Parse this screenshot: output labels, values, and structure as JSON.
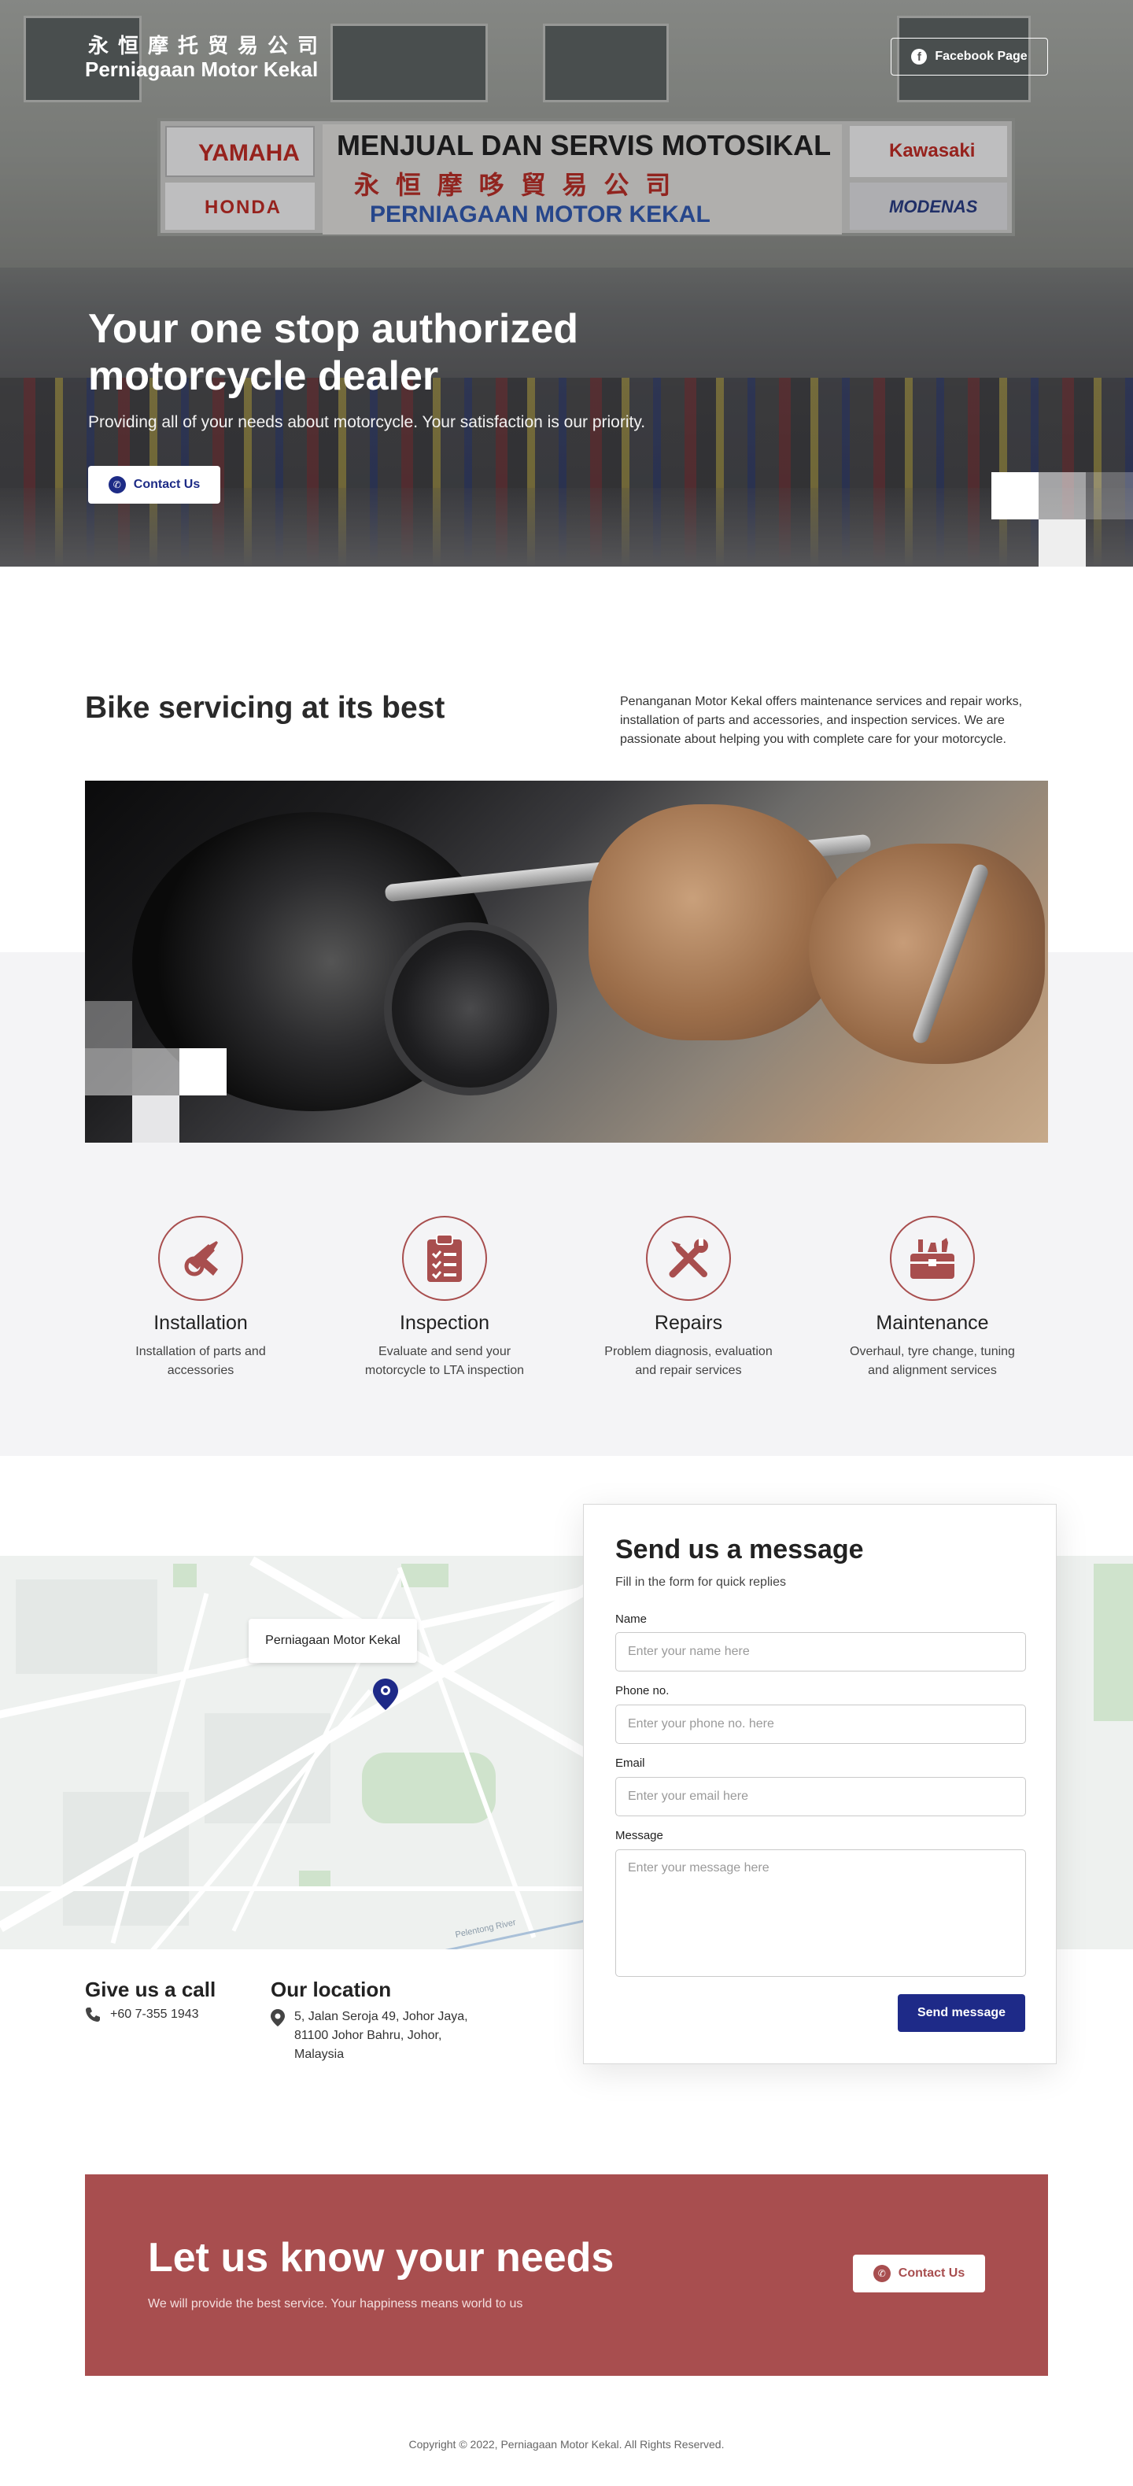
{
  "brand": {
    "name_cn": "永恒摩托贸易公司",
    "name_en": "Perniagaan Motor Kekal"
  },
  "hero": {
    "facebook_label": "Facebook Page",
    "title": "Your one stop authorized motorcycle dealer",
    "subtitle": "Providing all of your needs about motorcycle. Your satisfaction is our priority.",
    "contact_label": "Contact Us",
    "signs": {
      "yamaha": "YAMAHA",
      "honda": "HONDA",
      "main": "MENJUAL DAN SERVIS MOTOSIKAL",
      "cn": "永 恒 摩 哆 貿 易 公 司",
      "sub": "PERNIAGAAN MOTOR KEKAL",
      "kawasaki": "Kawasaki",
      "modenas": "MODENAS"
    }
  },
  "servicing": {
    "title": "Bike servicing at its best",
    "description": "Penanganan Motor Kekal offers maintenance services and repair works, installation of parts and accessories, and inspection services. We are passionate about helping you with complete care for your motorcycle."
  },
  "services": [
    {
      "title": "Installation",
      "description": "Installation of parts and accessories",
      "icon": "installation-icon"
    },
    {
      "title": "Inspection",
      "description": "Evaluate and send your motorcycle to LTA inspection",
      "icon": "clipboard-icon"
    },
    {
      "title": "Repairs",
      "description": "Problem diagnosis, evaluation and repair services",
      "icon": "tools-icon"
    },
    {
      "title": "Maintenance",
      "description": "Overhaul, tyre change, tuning and alignment services",
      "icon": "toolbox-icon"
    }
  ],
  "map": {
    "label": "Perniagaan Motor Kekal",
    "river": "Pelentong River"
  },
  "form": {
    "title": "Send us a message",
    "subtitle": "Fill in the form for quick replies",
    "name_label": "Name",
    "name_placeholder": "Enter your name here",
    "phone_label": "Phone no.",
    "phone_placeholder": "Enter your phone no. here",
    "email_label": "Email",
    "email_placeholder": "Enter your email here",
    "message_label": "Message",
    "message_placeholder": "Enter your message here",
    "submit_label": "Send message"
  },
  "contact": {
    "call_title": "Give us a call",
    "phone": "+60 7-355 1943",
    "location_title": "Our location",
    "address": "5, Jalan Seroja 49, Johor Jaya, 81100 Johor Bahru, Johor, Malaysia"
  },
  "cta": {
    "title": "Let us know your needs",
    "subtitle": "We will provide the best service. Your happiness means world to us",
    "contact_label": "Contact Us"
  },
  "footer": {
    "copyright": "Copyright © 2022, Perniagaan Motor Kekal. All Rights Reserved."
  },
  "colors": {
    "primary_blue": "#1e2a88",
    "accent_red": "#a84e4f",
    "light_gray": "#f4f4f6"
  }
}
